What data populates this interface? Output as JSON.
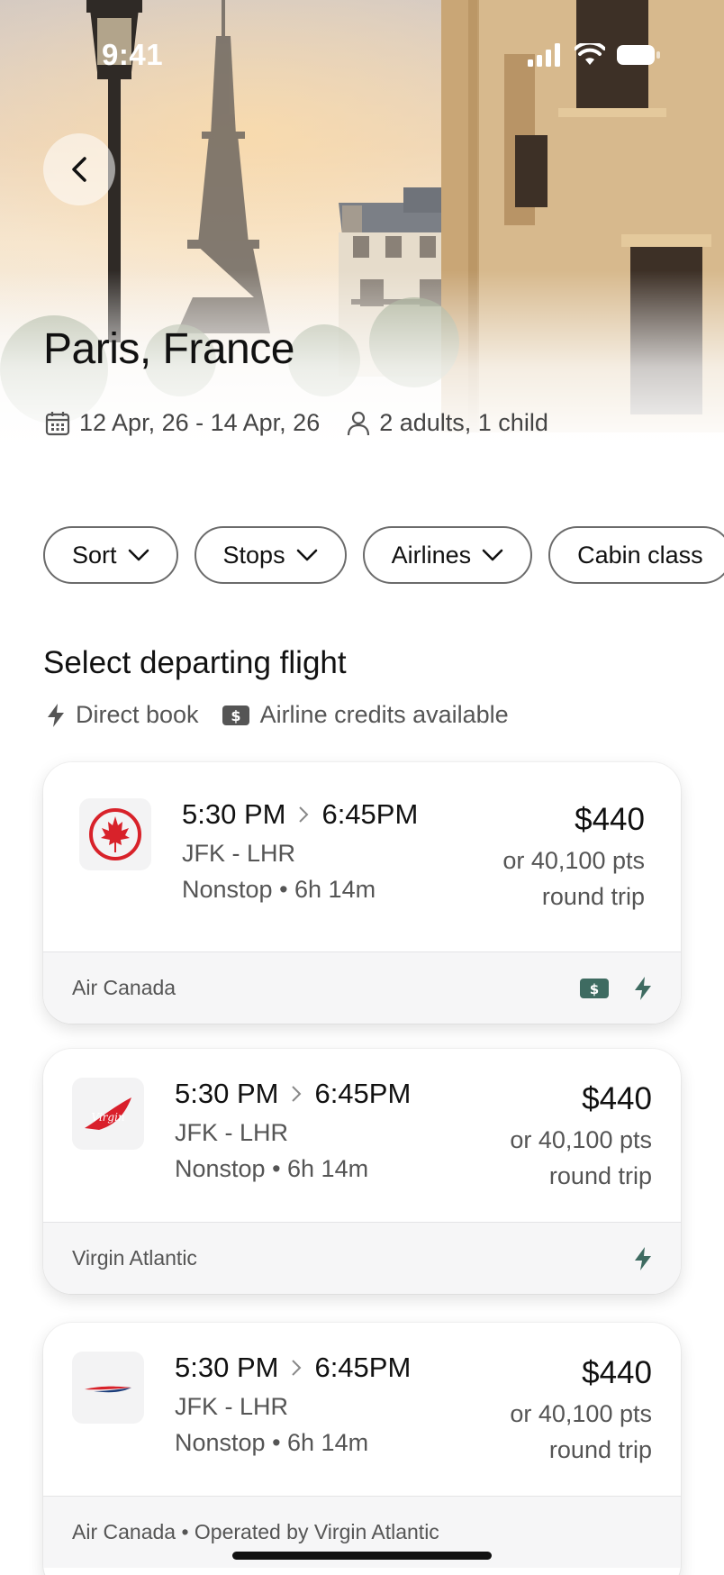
{
  "status_bar": {
    "time": "9:41"
  },
  "header": {
    "back_icon": "chevron-left-icon",
    "destination": "Paris, France",
    "dates": "12 Apr, 26 - 14 Apr, 26",
    "travellers": "2 adults, 1 child"
  },
  "filters": [
    {
      "label": "Sort"
    },
    {
      "label": "Stops"
    },
    {
      "label": "Airlines"
    },
    {
      "label": "Cabin class"
    }
  ],
  "section": {
    "title": "Select departing flight",
    "features": [
      "Direct book",
      "Airline credits available"
    ]
  },
  "colors": {
    "accent": "#3e6b61",
    "air_canada_red": "#d8222a",
    "virgin_red": "#d91f2b",
    "ba_blue": "#1a3c7a"
  },
  "flights": [
    {
      "logo_icon": "air-canada-logo-icon",
      "depart": "5:30 PM",
      "arrive": "6:45PM",
      "route": "JFK - LHR",
      "duration": "Nonstop • 6h 14m",
      "price": "$440",
      "points": "or 40,100 pts",
      "trip_type": "round trip",
      "airline": "Air Canada",
      "badges": [
        "airline-credit-icon",
        "direct-book-icon"
      ]
    },
    {
      "logo_icon": "virgin-atlantic-logo-icon",
      "depart": "5:30 PM",
      "arrive": "6:45PM",
      "route": "JFK - LHR",
      "duration": "Nonstop • 6h 14m",
      "price": "$440",
      "points": "or 40,100 pts",
      "trip_type": "round trip",
      "airline": "Virgin Atlantic",
      "badges": [
        "direct-book-icon"
      ]
    },
    {
      "logo_icon": "british-airways-logo-icon",
      "depart": "5:30 PM",
      "arrive": "6:45PM",
      "route": "JFK - LHR",
      "duration": "Nonstop • 6h 14m",
      "price": "$440",
      "points": "or 40,100 pts",
      "trip_type": "round trip",
      "airline": "Air Canada • Operated by Virgin Atlantic",
      "badges": []
    }
  ]
}
